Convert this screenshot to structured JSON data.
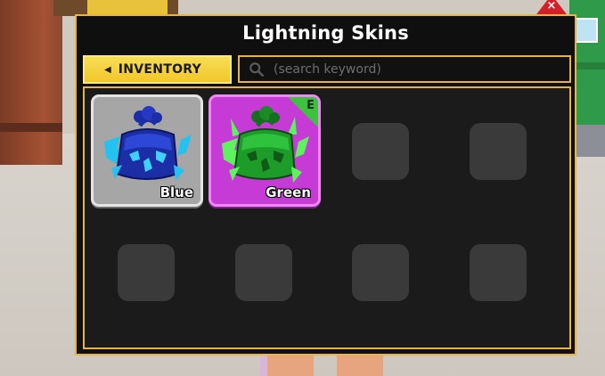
{
  "window": {
    "title": "Lightning Skins",
    "close_label": "×"
  },
  "toolbar": {
    "inventory_label": "INVENTORY"
  },
  "search": {
    "placeholder": "(search keyword)",
    "value": ""
  },
  "skins": [
    {
      "name": "Blue",
      "rarity_color": "#a6a6a6",
      "equipped": false
    },
    {
      "name": "Green",
      "rarity_color": "#c63bd6",
      "equipped": true,
      "equipped_badge": "E"
    }
  ],
  "empty_slot_count": 6,
  "colors": {
    "accent": "#e7b53d",
    "button": "#f2c72a",
    "panel": "#0f0f0f"
  },
  "icons": [
    "close-icon",
    "left-arrow-icon",
    "search-icon",
    "blue-lightning-fruit-icon",
    "green-lightning-fruit-icon"
  ]
}
